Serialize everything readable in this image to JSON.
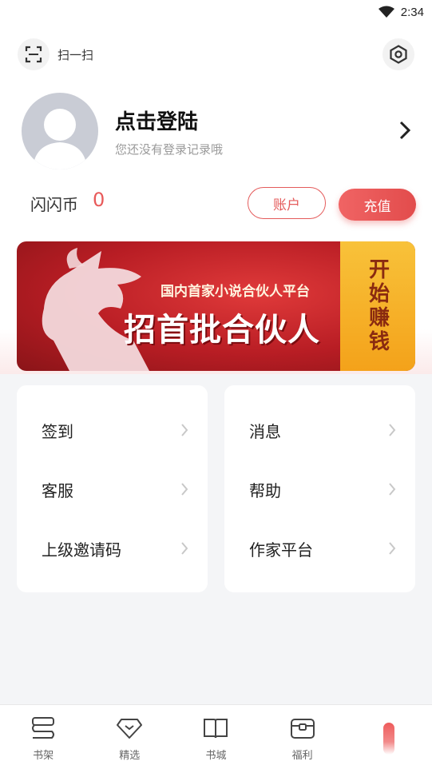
{
  "status_bar": {
    "time": "2:34",
    "wifi_icon": "wifi-icon"
  },
  "header": {
    "scan_icon": "scan-icon",
    "scan_label": "扫一扫",
    "settings_icon": "settings-icon"
  },
  "profile": {
    "avatar_icon": "avatar-placeholder-icon",
    "title": "点击登陆",
    "subtitle": "您还没有登录记录哦"
  },
  "coins": {
    "label": "闪闪币",
    "value": "0",
    "account_button": "账户",
    "recharge_button": "充值"
  },
  "banner": {
    "subtitle": "国内首家小说合伙人平台",
    "title": "招首批合伙人",
    "side_text": "开始赚钱"
  },
  "menu_left": [
    {
      "label": "签到"
    },
    {
      "label": "客服"
    },
    {
      "label": "上级邀请码"
    }
  ],
  "menu_right": [
    {
      "label": "消息"
    },
    {
      "label": "帮助"
    },
    {
      "label": "作家平台"
    }
  ],
  "tabbar": [
    {
      "label": "书架",
      "icon": "bookshelf-icon"
    },
    {
      "label": "精选",
      "icon": "diamond-icon"
    },
    {
      "label": "书城",
      "icon": "book-icon"
    },
    {
      "label": "福利",
      "icon": "gift-box-icon"
    },
    {
      "label": "",
      "icon": "profile-active-indicator"
    }
  ],
  "colors": {
    "accent": "#e24c4c",
    "banner_red": "#b81d24",
    "banner_gold": "#f4a21a"
  }
}
